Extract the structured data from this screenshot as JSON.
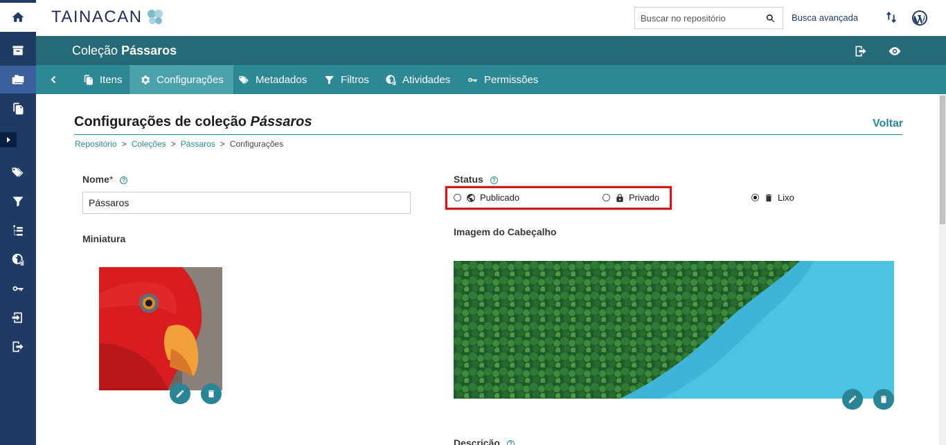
{
  "sidebar": {
    "items": [
      "home-icon",
      "archive-icon",
      "collections-icon",
      "items-icon",
      "expand-icon",
      "tags-icon",
      "filter-icon",
      "taxonomy-icon",
      "activities-icon",
      "key-icon",
      "import-icon",
      "export-icon"
    ]
  },
  "header": {
    "logo": "Tainacan",
    "search_placeholder": "Buscar no repositório",
    "advanced_search": "Busca avançada"
  },
  "collection": {
    "prefix": "Coleção",
    "name": "Pássaros"
  },
  "tabs": [
    {
      "label": "Itens",
      "icon": "items-icon"
    },
    {
      "label": "Configurações",
      "icon": "gear-icon",
      "active": true
    },
    {
      "label": "Metadados",
      "icon": "tags-icon"
    },
    {
      "label": "Filtros",
      "icon": "filter-icon"
    },
    {
      "label": "Atividades",
      "icon": "activities-icon"
    },
    {
      "label": "Permissões",
      "icon": "key-icon"
    }
  ],
  "page": {
    "title_prefix": "Configurações de coleção",
    "title_collection": "Pássaros",
    "back": "Voltar",
    "breadcrumb": [
      "Repositório",
      "Coleções",
      "Pássaros",
      "Configurações"
    ],
    "breadcrumb_sep": ">"
  },
  "form": {
    "name_label": "Nome",
    "name_required": "*",
    "name_value": "Pássaros",
    "thumbnail_label": "Miniatura",
    "status_label": "Status",
    "status_options": [
      {
        "label": "Publicado",
        "icon": "globe-icon",
        "selected": false
      },
      {
        "label": "Privado",
        "icon": "lock-icon",
        "selected": false
      },
      {
        "label": "Lixo",
        "icon": "trash-icon",
        "selected": true
      }
    ],
    "header_image_label": "Imagem do Cabeçalho",
    "description_label": "Descrição"
  },
  "colors": {
    "sidebar": "#1f3b64",
    "collection_bar": "#256a76",
    "tabs_bar": "#2c8894",
    "active_tab": "#4ba2ad",
    "highlight": "#d01818"
  }
}
